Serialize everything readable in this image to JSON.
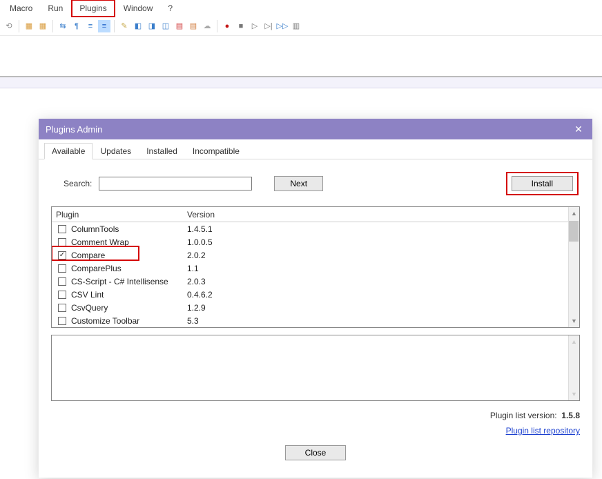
{
  "menubar": [
    "Macro",
    "Run",
    "Plugins",
    "Window",
    "?"
  ],
  "dialog": {
    "title": "Plugins Admin",
    "tabs": [
      "Available",
      "Updates",
      "Installed",
      "Incompatible"
    ],
    "search_label": "Search:",
    "next_label": "Next",
    "install_label": "Install",
    "header_plugin": "Plugin",
    "header_version": "Version",
    "plugins": [
      {
        "name": "ColumnTools",
        "version": "1.4.5.1",
        "checked": false
      },
      {
        "name": "Comment Wrap",
        "version": "1.0.0.5",
        "checked": false
      },
      {
        "name": "Compare",
        "version": "2.0.2",
        "checked": true
      },
      {
        "name": "ComparePlus",
        "version": "1.1",
        "checked": false
      },
      {
        "name": "CS-Script - C# Intellisense",
        "version": "2.0.3",
        "checked": false
      },
      {
        "name": "CSV Lint",
        "version": "0.4.6.2",
        "checked": false
      },
      {
        "name": "CsvQuery",
        "version": "1.2.9",
        "checked": false
      },
      {
        "name": "Customize Toolbar",
        "version": "5.3",
        "checked": false
      }
    ],
    "plugin_list_version_label": "Plugin list version:",
    "plugin_list_version": "1.5.8",
    "repository_link": "Plugin list repository",
    "close_label": "Close"
  }
}
